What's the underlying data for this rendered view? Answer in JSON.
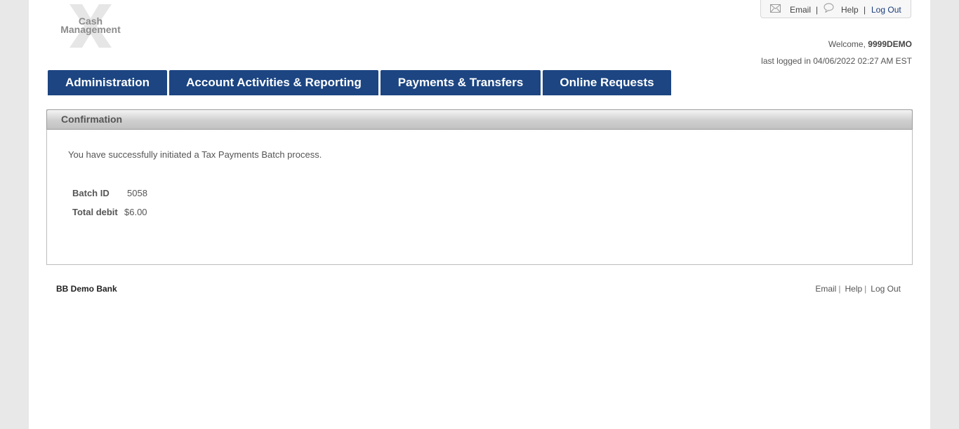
{
  "logo": {
    "line1": "Cash",
    "line2": "Management"
  },
  "utility": {
    "email": "Email",
    "help": "Help",
    "logout": "Log Out",
    "separator": "|"
  },
  "user": {
    "welcome_prefix": "Welcome,",
    "username": "9999DEMO",
    "last_logged": "last logged in 04/06/2022 02:27 AM EST"
  },
  "nav": {
    "tabs": [
      {
        "label": "Administration"
      },
      {
        "label": "Account Activities & Reporting"
      },
      {
        "label": "Payments & Transfers"
      },
      {
        "label": "Online Requests"
      }
    ]
  },
  "confirmation": {
    "title": "Confirmation",
    "message": "You have successfully initiated a Tax Payments Batch process.",
    "fields": [
      {
        "label": "Batch ID",
        "value": "5058"
      },
      {
        "label": "Total debit",
        "value": "$6.00"
      }
    ]
  },
  "footer": {
    "bank_name": "BB Demo Bank",
    "email": "Email",
    "help": "Help",
    "logout": "Log Out",
    "separator": "|"
  },
  "colors": {
    "nav_tab_bg": "#1c4582",
    "page_bg": "#e8e8e8",
    "logout_link": "#1b3d7a"
  }
}
